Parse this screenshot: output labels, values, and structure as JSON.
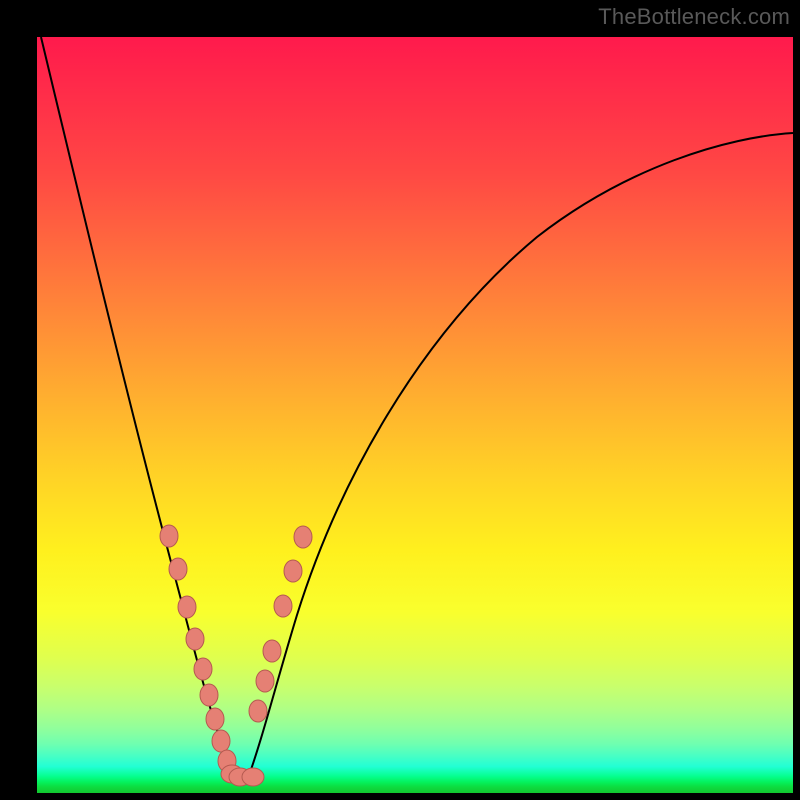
{
  "watermark": "TheBottleneck.com",
  "colors": {
    "bead_fill": "#e58074",
    "bead_stroke": "#b55a50",
    "curve_stroke": "#000000"
  },
  "chart_data": {
    "type": "line",
    "title": "",
    "xlabel": "",
    "ylabel": "",
    "xlim": [
      0,
      100
    ],
    "ylim": [
      0,
      100
    ],
    "note": "V-shaped bottleneck curve; min near x≈26; overlaid bead markers near the trough segments",
    "series": [
      {
        "name": "left-branch",
        "x": [
          0,
          3,
          6,
          9,
          12,
          14,
          16,
          18,
          20,
          22,
          23.5,
          25,
          26
        ],
        "y": [
          100,
          86,
          74,
          63,
          52,
          45,
          38,
          31,
          23,
          15,
          9,
          3,
          1
        ]
      },
      {
        "name": "right-branch",
        "x": [
          26,
          27.5,
          29,
          31.5,
          34,
          38,
          44,
          52,
          60,
          70,
          82,
          94,
          100
        ],
        "y": [
          1,
          4,
          10,
          20,
          30,
          42,
          55,
          66,
          73,
          79,
          83,
          86,
          87
        ]
      }
    ],
    "markers": [
      {
        "x": 17.5,
        "y": 34
      },
      {
        "x": 18.8,
        "y": 29
      },
      {
        "x": 20.0,
        "y": 24
      },
      {
        "x": 21.0,
        "y": 20
      },
      {
        "x": 22.0,
        "y": 16
      },
      {
        "x": 22.8,
        "y": 12.5
      },
      {
        "x": 23.5,
        "y": 9.5
      },
      {
        "x": 24.3,
        "y": 6.5
      },
      {
        "x": 25.2,
        "y": 3.8
      },
      {
        "x": 25.8,
        "y": 2.2
      },
      {
        "x": 26.8,
        "y": 2.0
      },
      {
        "x": 28.5,
        "y": 2.0
      },
      {
        "x": 29.3,
        "y": 11
      },
      {
        "x": 30.2,
        "y": 15
      },
      {
        "x": 31.0,
        "y": 19
      },
      {
        "x": 32.5,
        "y": 25
      },
      {
        "x": 33.8,
        "y": 29.5
      },
      {
        "x": 35.2,
        "y": 34
      }
    ]
  }
}
